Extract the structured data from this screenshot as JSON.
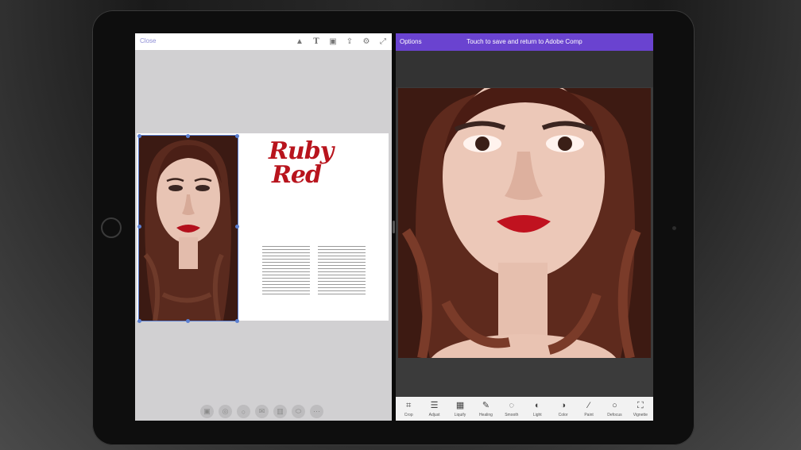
{
  "left_pane": {
    "close_label": "Close",
    "toolbar_icons": [
      "shapes-icon",
      "text-icon",
      "image-icon",
      "share-icon",
      "settings-icon",
      "expand-icon"
    ],
    "layout_title_line1": "Ruby",
    "layout_title_line2": "Red",
    "bottom_icons": [
      "image-icon",
      "circle-icon",
      "circle-icon",
      "mail-icon",
      "trash-icon",
      "shape-icon",
      "more-icon"
    ]
  },
  "right_pane": {
    "options_label": "Options",
    "banner_text": "Touch to save and return to Adobe Comp",
    "tools": [
      {
        "label": "Crop",
        "icon": "⌗"
      },
      {
        "label": "Adjust",
        "icon": "☰"
      },
      {
        "label": "Liquify",
        "icon": "▦"
      },
      {
        "label": "Healing",
        "icon": "✎"
      },
      {
        "label": "Smooth",
        "icon": "◌"
      },
      {
        "label": "Light",
        "icon": "◐"
      },
      {
        "label": "Color",
        "icon": "◑"
      },
      {
        "label": "Paint",
        "icon": "⁄"
      },
      {
        "label": "Defocus",
        "icon": "○"
      },
      {
        "label": "Vignette",
        "icon": "⛶"
      }
    ]
  },
  "colors": {
    "accent": "#6a43d0",
    "title_red": "#b8141d",
    "selection": "#5b7fd1"
  }
}
